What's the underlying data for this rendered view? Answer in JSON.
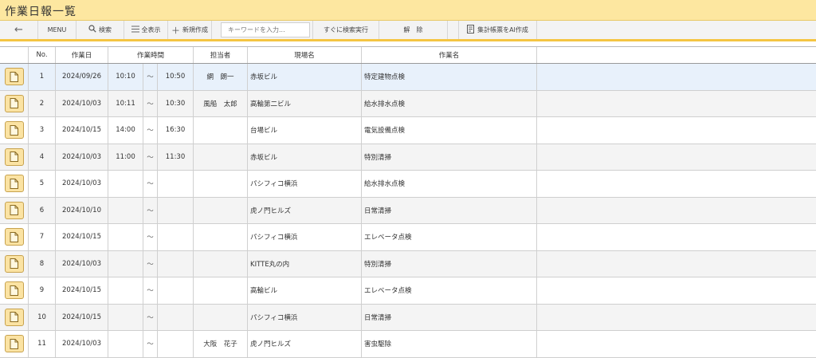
{
  "window": {
    "title": "作業日報一覧"
  },
  "toolbar": {
    "back_label": "←",
    "menu_label": "MENU",
    "search_label": "検索",
    "show_all_label": "全表示",
    "new_label": "新規作成",
    "keyword_placeholder": "キーワードを入力...",
    "quick_search_label": "すぐに検索実行",
    "release_label": "解　除",
    "ai_report_label": "集計帳票をAI作成"
  },
  "table": {
    "columns": {
      "no": "No.",
      "date": "作業日",
      "time": "作業時間",
      "person": "担当者",
      "site": "現場名",
      "work": "作業名"
    },
    "rows": [
      {
        "no": "1",
        "date": "2024/09/26",
        "start": "10:10",
        "tilde": "〜",
        "end": "10:50",
        "person": "網　朗一",
        "site": "赤坂ビル",
        "work": "特定建物点検"
      },
      {
        "no": "2",
        "date": "2024/10/03",
        "start": "10:11",
        "tilde": "〜",
        "end": "10:30",
        "person": "風船　太郎",
        "site": "高輪第二ビル",
        "work": "給水排水点検"
      },
      {
        "no": "3",
        "date": "2024/10/15",
        "start": "14:00",
        "tilde": "〜",
        "end": "16:30",
        "person": "",
        "site": "台場ビル",
        "work": "電気設備点検"
      },
      {
        "no": "4",
        "date": "2024/10/03",
        "start": "11:00",
        "tilde": "〜",
        "end": "11:30",
        "person": "",
        "site": "赤坂ビル",
        "work": "特別清掃"
      },
      {
        "no": "5",
        "date": "2024/10/03",
        "start": "",
        "tilde": "〜",
        "end": "",
        "person": "",
        "site": "パシフィコ横浜",
        "work": "給水排水点検"
      },
      {
        "no": "6",
        "date": "2024/10/10",
        "start": "",
        "tilde": "〜",
        "end": "",
        "person": "",
        "site": "虎ノ門ヒルズ",
        "work": "日常清掃"
      },
      {
        "no": "7",
        "date": "2024/10/15",
        "start": "",
        "tilde": "〜",
        "end": "",
        "person": "",
        "site": "パシフィコ横浜",
        "work": "エレベータ点検"
      },
      {
        "no": "8",
        "date": "2024/10/03",
        "start": "",
        "tilde": "〜",
        "end": "",
        "person": "",
        "site": "KITTE丸の内",
        "work": "特別清掃"
      },
      {
        "no": "9",
        "date": "2024/10/15",
        "start": "",
        "tilde": "〜",
        "end": "",
        "person": "",
        "site": "高輪ビル",
        "work": "エレベータ点検"
      },
      {
        "no": "10",
        "date": "2024/10/15",
        "start": "",
        "tilde": "〜",
        "end": "",
        "person": "",
        "site": "パシフィコ横浜",
        "work": "日常清掃"
      },
      {
        "no": "11",
        "date": "2024/10/03",
        "start": "",
        "tilde": "〜",
        "end": "",
        "person": "大阪　花子",
        "site": "虎ノ門ヒルズ",
        "work": "害虫駆除"
      }
    ]
  },
  "icons": {
    "back": "arrow-left-icon",
    "search": "magnifier-icon",
    "list": "list-icon",
    "plus": "plus-icon",
    "report": "report-icon",
    "doc": "document-icon"
  },
  "colors": {
    "title_bar": "#fde7a0",
    "toolbar_accent": "#f5c542",
    "doc_button": "#fbe3a3",
    "selected_row": "#e8f1fb"
  }
}
